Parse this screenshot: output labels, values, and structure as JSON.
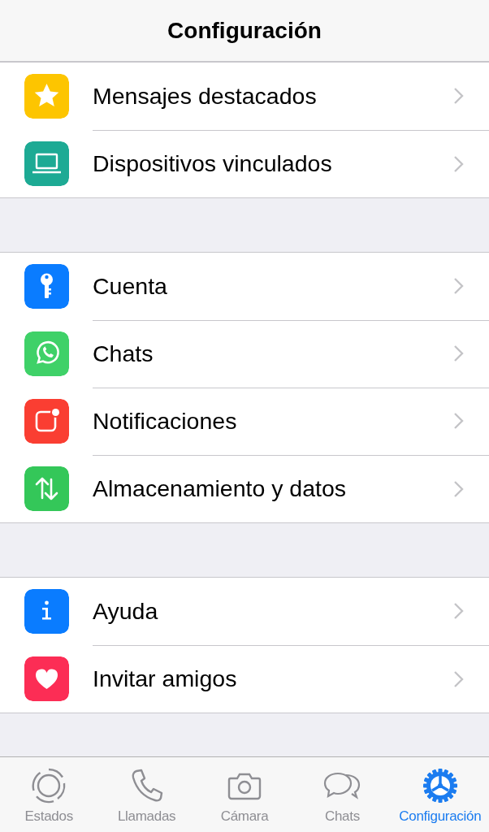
{
  "header": {
    "title": "Configuración"
  },
  "sections": [
    {
      "items": [
        {
          "label": "Mensajes destacados",
          "kind": "star",
          "color": "#fdc500"
        },
        {
          "label": "Dispositivos vinculados",
          "kind": "laptop",
          "color": "#1daa94"
        }
      ]
    },
    {
      "items": [
        {
          "label": "Cuenta",
          "kind": "key",
          "color": "#0a7cff"
        },
        {
          "label": "Chats",
          "kind": "chat",
          "color": "#3fd168"
        },
        {
          "label": "Notificaciones",
          "kind": "notification",
          "color": "#fa3e32"
        },
        {
          "label": "Almacenamiento y datos",
          "kind": "arrows",
          "color": "#34c759"
        }
      ]
    },
    {
      "items": [
        {
          "label": "Ayuda",
          "kind": "info",
          "color": "#0a7cff"
        },
        {
          "label": "Invitar amigos",
          "kind": "heart",
          "color": "#fc2d55"
        }
      ]
    }
  ],
  "tabs": [
    {
      "label": "Estados",
      "kind": "status",
      "selected": false
    },
    {
      "label": "Llamadas",
      "kind": "phone",
      "selected": false
    },
    {
      "label": "Cámara",
      "kind": "camera",
      "selected": false
    },
    {
      "label": "Chats",
      "kind": "chats",
      "selected": false
    },
    {
      "label": "Configuración",
      "kind": "gear",
      "selected": true
    }
  ]
}
